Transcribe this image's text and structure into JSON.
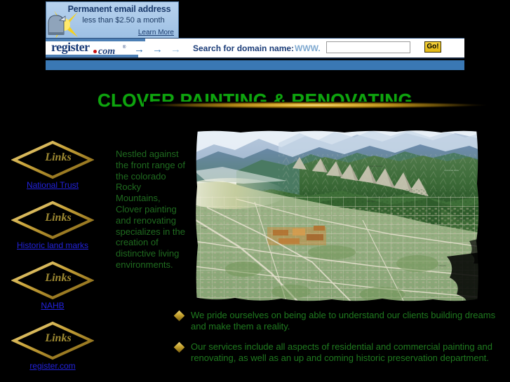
{
  "ad": {
    "promo_headline": "Permanent email address",
    "promo_subtext": "less than $2.50 a month",
    "learn_more": "Learn More",
    "brand_name": "register",
    "brand_suffix": "com",
    "brand_tm": "®",
    "arrow_glyph": "→",
    "search_label": "Search for domain name:",
    "www_prefix": "WWW.",
    "domain_input_value": "",
    "domain_input_placeholder": "",
    "go_label": "Go!",
    "blue_bar_color": "#3a78b4"
  },
  "header": {
    "title": "CLOVER PAINTING & RENOVATING",
    "title_color": "#0ea50e",
    "divider_color": "#e3b93e"
  },
  "sidebar": {
    "badge_label": "Links",
    "items": [
      {
        "badge": "Links",
        "label": "National Trust"
      },
      {
        "badge": "Links",
        "label": "Historic land marks"
      },
      {
        "badge": "Links",
        "label": "NAHB"
      },
      {
        "badge": "Links",
        "label": "register.com"
      }
    ]
  },
  "main": {
    "intro_paragraph": "Nestled against the front range of the colorado Rocky Mountains, Clover painting and renovating specializes in the creation of distinctive living environments.",
    "photo_alt": "Aerial illustration of Boulder Colorado with the Flatirons and Front Range",
    "bullets": [
      "We pride ourselves on being able to understand our clients building dreams and make them a reality.",
      "Our services include all aspects of residential and commercial painting and renovating, as well as an up and coming historic preservation department."
    ]
  },
  "colors": {
    "background": "#000000",
    "gold": "#c5a12c",
    "green_text": "#1f7a1f",
    "link_blue": "#2222dd"
  }
}
